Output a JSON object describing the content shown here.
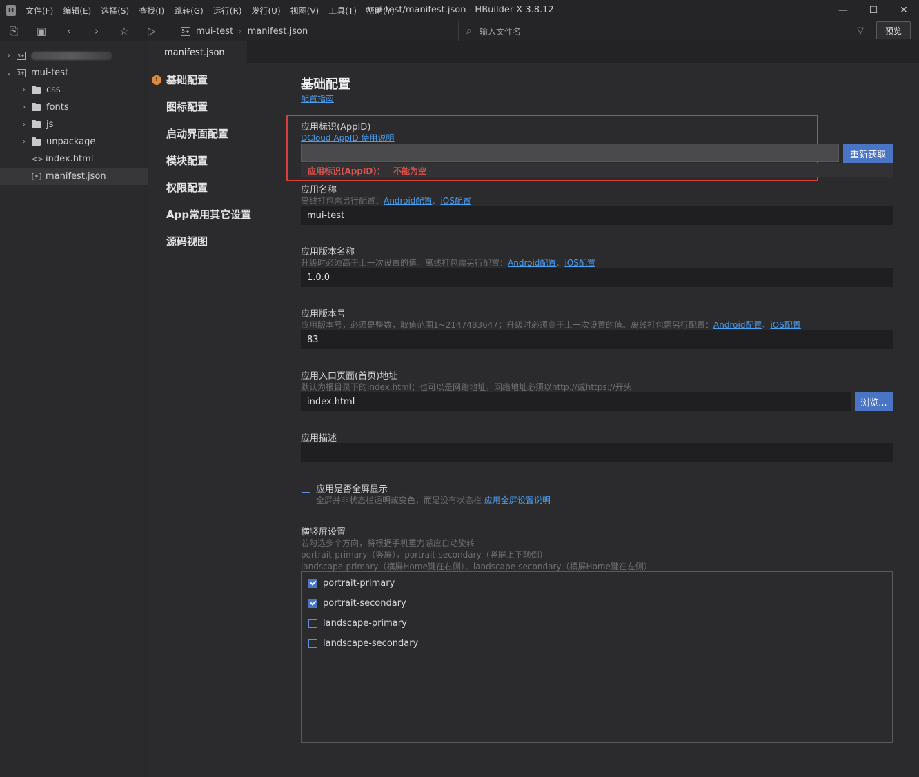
{
  "window": {
    "title": "mui-test/manifest.json - HBuilder X 3.8.12",
    "logo": "H",
    "menu": [
      "文件(F)",
      "编辑(E)",
      "选择(S)",
      "查找(I)",
      "跳转(G)",
      "运行(R)",
      "发行(U)",
      "视图(V)",
      "工具(T)",
      "帮助(Y)"
    ],
    "min": "—",
    "max": "☐",
    "close": "✕"
  },
  "toolbar": {
    "breadcrumb": [
      "mui-test",
      "manifest.json"
    ],
    "file_search_placeholder": "输入文件名",
    "preview_label": "预览"
  },
  "tree": {
    "items": [
      {
        "label": "mui-test",
        "kind": "project"
      },
      {
        "label": "css",
        "kind": "folder"
      },
      {
        "label": "fonts",
        "kind": "folder"
      },
      {
        "label": "js",
        "kind": "folder"
      },
      {
        "label": "unpackage",
        "kind": "folder"
      },
      {
        "label": "index.html",
        "kind": "file"
      },
      {
        "label": "manifest.json",
        "kind": "file"
      }
    ]
  },
  "tab": {
    "label": "manifest.json"
  },
  "nav": {
    "items": [
      "基础配置",
      "图标配置",
      "启动界面配置",
      "模块配置",
      "权限配置",
      "App常用其它设置",
      "源码视图"
    ]
  },
  "form": {
    "title": "基础配置",
    "guide_link": "配置指南",
    "appid": {
      "label": "应用标识(AppID)",
      "help_link": "DCloud AppID 使用说明",
      "value": "",
      "refresh_button": "重新获取",
      "error_label": "应用标识(AppID)：",
      "error_msg": "不能为空"
    },
    "app_name": {
      "label": "应用名称",
      "hint": "离线打包需另行配置：",
      "android": "Android配置",
      "sep": "、",
      "ios": "iOS配置",
      "value": "mui-test"
    },
    "version_name": {
      "label": "应用版本名称",
      "hint": "升级时必须高于上一次设置的值。离线打包需另行配置：",
      "android": "Android配置",
      "sep": "、",
      "ios": "iOS配置",
      "value": "1.0.0"
    },
    "version_code": {
      "label": "应用版本号",
      "hint": "应用版本号，必须是整数，取值范围1~2147483647；升级时必须高于上一次设置的值。离线打包需另行配置：",
      "android": "Android配置",
      "sep": "、",
      "ios": "iOS配置",
      "value": "83"
    },
    "entry": {
      "label": "应用入口页面(首页)地址",
      "hint": "默认为根目录下的index.html；也可以是网络地址，网络地址必须以http://或https://开头",
      "value": "index.html",
      "browse_button": "浏览..."
    },
    "description": {
      "label": "应用描述",
      "value": ""
    },
    "fullscreen": {
      "label": "应用是否全屏显示",
      "hint": "全屏并非状态栏透明或变色，而是没有状态栏",
      "link": "应用全屏设置说明",
      "checked": false
    },
    "orientation": {
      "label": "横竖屏设置",
      "hint1": "若勾选多个方向，将根据手机重力感应自动旋转",
      "hint2": "portrait-primary（竖屏），portrait-secondary（竖屏上下颠倒）",
      "hint3": "landscape-primary（横屏Home键在右侧）、landscape-secondary（横屏Home键在左侧）",
      "options": [
        {
          "label": "portrait-primary",
          "checked": true
        },
        {
          "label": "portrait-secondary",
          "checked": true
        },
        {
          "label": "landscape-primary",
          "checked": false
        },
        {
          "label": "landscape-secondary",
          "checked": false
        }
      ]
    }
  },
  "colors": {
    "accent": "#4a74c4",
    "error": "#d9534f",
    "link": "#4a9ef0"
  }
}
